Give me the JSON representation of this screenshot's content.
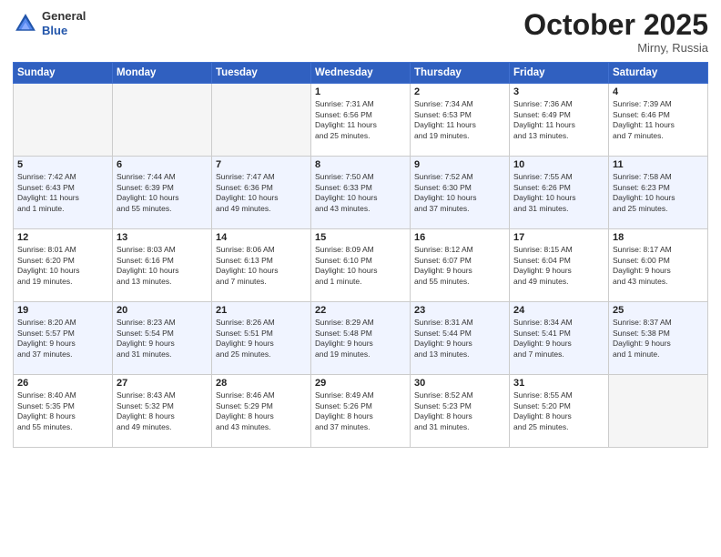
{
  "header": {
    "logo_general": "General",
    "logo_blue": "Blue",
    "month": "October 2025",
    "location": "Mirny, Russia"
  },
  "weekdays": [
    "Sunday",
    "Monday",
    "Tuesday",
    "Wednesday",
    "Thursday",
    "Friday",
    "Saturday"
  ],
  "weeks": [
    [
      {
        "day": "",
        "info": ""
      },
      {
        "day": "",
        "info": ""
      },
      {
        "day": "",
        "info": ""
      },
      {
        "day": "1",
        "info": "Sunrise: 7:31 AM\nSunset: 6:56 PM\nDaylight: 11 hours\nand 25 minutes."
      },
      {
        "day": "2",
        "info": "Sunrise: 7:34 AM\nSunset: 6:53 PM\nDaylight: 11 hours\nand 19 minutes."
      },
      {
        "day": "3",
        "info": "Sunrise: 7:36 AM\nSunset: 6:49 PM\nDaylight: 11 hours\nand 13 minutes."
      },
      {
        "day": "4",
        "info": "Sunrise: 7:39 AM\nSunset: 6:46 PM\nDaylight: 11 hours\nand 7 minutes."
      }
    ],
    [
      {
        "day": "5",
        "info": "Sunrise: 7:42 AM\nSunset: 6:43 PM\nDaylight: 11 hours\nand 1 minute."
      },
      {
        "day": "6",
        "info": "Sunrise: 7:44 AM\nSunset: 6:39 PM\nDaylight: 10 hours\nand 55 minutes."
      },
      {
        "day": "7",
        "info": "Sunrise: 7:47 AM\nSunset: 6:36 PM\nDaylight: 10 hours\nand 49 minutes."
      },
      {
        "day": "8",
        "info": "Sunrise: 7:50 AM\nSunset: 6:33 PM\nDaylight: 10 hours\nand 43 minutes."
      },
      {
        "day": "9",
        "info": "Sunrise: 7:52 AM\nSunset: 6:30 PM\nDaylight: 10 hours\nand 37 minutes."
      },
      {
        "day": "10",
        "info": "Sunrise: 7:55 AM\nSunset: 6:26 PM\nDaylight: 10 hours\nand 31 minutes."
      },
      {
        "day": "11",
        "info": "Sunrise: 7:58 AM\nSunset: 6:23 PM\nDaylight: 10 hours\nand 25 minutes."
      }
    ],
    [
      {
        "day": "12",
        "info": "Sunrise: 8:01 AM\nSunset: 6:20 PM\nDaylight: 10 hours\nand 19 minutes."
      },
      {
        "day": "13",
        "info": "Sunrise: 8:03 AM\nSunset: 6:16 PM\nDaylight: 10 hours\nand 13 minutes."
      },
      {
        "day": "14",
        "info": "Sunrise: 8:06 AM\nSunset: 6:13 PM\nDaylight: 10 hours\nand 7 minutes."
      },
      {
        "day": "15",
        "info": "Sunrise: 8:09 AM\nSunset: 6:10 PM\nDaylight: 10 hours\nand 1 minute."
      },
      {
        "day": "16",
        "info": "Sunrise: 8:12 AM\nSunset: 6:07 PM\nDaylight: 9 hours\nand 55 minutes."
      },
      {
        "day": "17",
        "info": "Sunrise: 8:15 AM\nSunset: 6:04 PM\nDaylight: 9 hours\nand 49 minutes."
      },
      {
        "day": "18",
        "info": "Sunrise: 8:17 AM\nSunset: 6:00 PM\nDaylight: 9 hours\nand 43 minutes."
      }
    ],
    [
      {
        "day": "19",
        "info": "Sunrise: 8:20 AM\nSunset: 5:57 PM\nDaylight: 9 hours\nand 37 minutes."
      },
      {
        "day": "20",
        "info": "Sunrise: 8:23 AM\nSunset: 5:54 PM\nDaylight: 9 hours\nand 31 minutes."
      },
      {
        "day": "21",
        "info": "Sunrise: 8:26 AM\nSunset: 5:51 PM\nDaylight: 9 hours\nand 25 minutes."
      },
      {
        "day": "22",
        "info": "Sunrise: 8:29 AM\nSunset: 5:48 PM\nDaylight: 9 hours\nand 19 minutes."
      },
      {
        "day": "23",
        "info": "Sunrise: 8:31 AM\nSunset: 5:44 PM\nDaylight: 9 hours\nand 13 minutes."
      },
      {
        "day": "24",
        "info": "Sunrise: 8:34 AM\nSunset: 5:41 PM\nDaylight: 9 hours\nand 7 minutes."
      },
      {
        "day": "25",
        "info": "Sunrise: 8:37 AM\nSunset: 5:38 PM\nDaylight: 9 hours\nand 1 minute."
      }
    ],
    [
      {
        "day": "26",
        "info": "Sunrise: 8:40 AM\nSunset: 5:35 PM\nDaylight: 8 hours\nand 55 minutes."
      },
      {
        "day": "27",
        "info": "Sunrise: 8:43 AM\nSunset: 5:32 PM\nDaylight: 8 hours\nand 49 minutes."
      },
      {
        "day": "28",
        "info": "Sunrise: 8:46 AM\nSunset: 5:29 PM\nDaylight: 8 hours\nand 43 minutes."
      },
      {
        "day": "29",
        "info": "Sunrise: 8:49 AM\nSunset: 5:26 PM\nDaylight: 8 hours\nand 37 minutes."
      },
      {
        "day": "30",
        "info": "Sunrise: 8:52 AM\nSunset: 5:23 PM\nDaylight: 8 hours\nand 31 minutes."
      },
      {
        "day": "31",
        "info": "Sunrise: 8:55 AM\nSunset: 5:20 PM\nDaylight: 8 hours\nand 25 minutes."
      },
      {
        "day": "",
        "info": ""
      }
    ]
  ]
}
